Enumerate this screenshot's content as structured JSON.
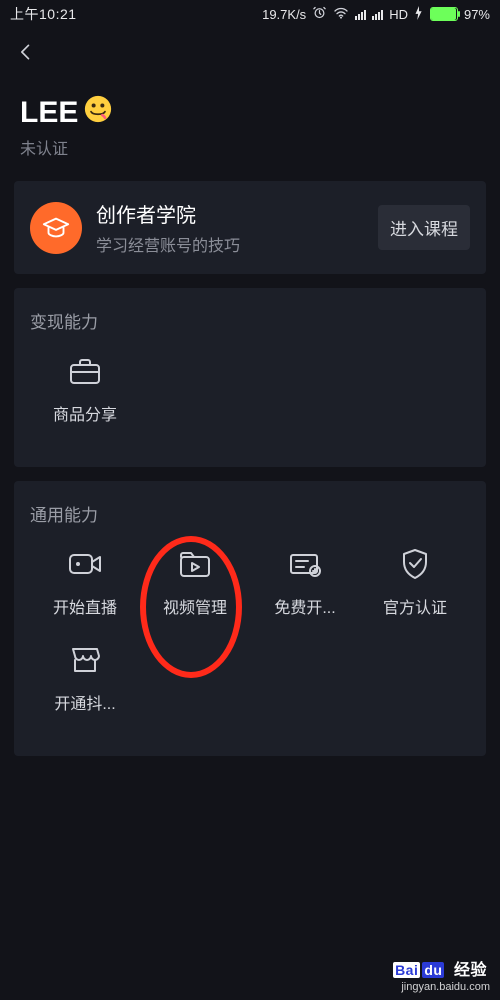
{
  "status": {
    "time": "上午10:21",
    "speed": "19.7K/s",
    "hd": "HD",
    "battery_pct": "97%"
  },
  "profile": {
    "name": "LEE",
    "verify": "未认证"
  },
  "academy": {
    "title": "创作者学院",
    "sub": "学习经营账号的技巧",
    "btn": "进入课程"
  },
  "monetize": {
    "title": "变现能力",
    "items": [
      {
        "label": "商品分享"
      }
    ]
  },
  "general": {
    "title": "通用能力",
    "items": [
      {
        "label": "开始直播"
      },
      {
        "label": "视频管理"
      },
      {
        "label": "免费开..."
      },
      {
        "label": "官方认证"
      },
      {
        "label": "开通抖..."
      }
    ]
  },
  "watermark": {
    "brand_a": "Bai",
    "brand_b": "du",
    "brand_c": "经验",
    "url": "jingyan.baidu.com"
  }
}
